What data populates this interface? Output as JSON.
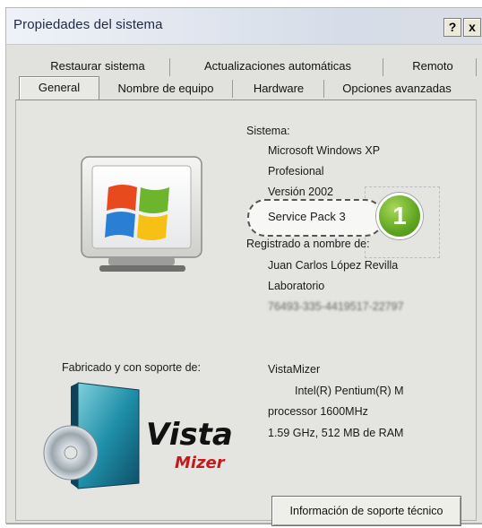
{
  "window": {
    "title": "Propiedades del sistema",
    "help_label": "?",
    "close_label": "x"
  },
  "tabs": {
    "row1": [
      "Restaurar sistema",
      "Actualizaciones automáticas",
      "Remoto"
    ],
    "row2": [
      "General",
      "Nombre de equipo",
      "Hardware",
      "Opciones avanzadas"
    ],
    "active": "General"
  },
  "system": {
    "heading": "Sistema:",
    "os": "Microsoft Windows XP",
    "edition": "Profesional",
    "version": "Versión 2002",
    "service_pack": "Service Pack 3"
  },
  "registered": {
    "heading": "Registrado a nombre de:",
    "name": "Juan Carlos López Revilla",
    "org": "Laboratorio",
    "serial": "76493-335-4419517-22797"
  },
  "manufacturer": {
    "heading": "Fabricado y con soporte de:",
    "name": "VistaMizer",
    "cpu_line1": "Intel(R) Pentium(R) M",
    "cpu_line2": "processor 1600MHz",
    "cpu_line3": "1.59 GHz, 512 MB de RAM",
    "logo_main": "Vista",
    "logo_sub": "Mizer"
  },
  "callout": {
    "number": "1"
  },
  "support_button": {
    "label": "Información de soporte técnico"
  },
  "colors": {
    "panel": "#e4e4e0",
    "badge": "#5fa520",
    "logo_red": "#c41a1a"
  }
}
